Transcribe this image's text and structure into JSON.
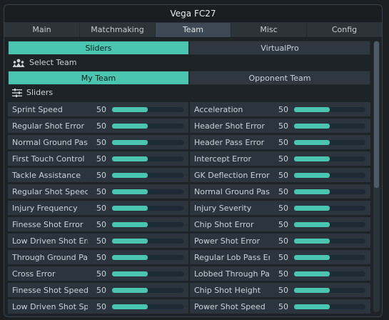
{
  "window": {
    "title": "Vega FC27"
  },
  "tabs": [
    {
      "label": "Main",
      "active": false
    },
    {
      "label": "Matchmaking",
      "active": false
    },
    {
      "label": "Team",
      "active": true
    },
    {
      "label": "Misc",
      "active": false
    },
    {
      "label": "Config",
      "active": false
    }
  ],
  "mode_tabs": [
    {
      "label": "Sliders",
      "active": true
    },
    {
      "label": "VirtualPro",
      "active": false
    }
  ],
  "select_team": {
    "label": "Select Team",
    "icon": "team-icon"
  },
  "team_tabs": [
    {
      "label": "My Team",
      "active": true
    },
    {
      "label": "Opponent Team",
      "active": false
    }
  ],
  "sliders_section": {
    "label": "Sliders",
    "icon": "sliders-icon"
  },
  "colors": {
    "accent": "#49c5b1",
    "track": "#1c2a36",
    "row_bg": "#2c353d"
  },
  "slider_max": 100,
  "sliders": [
    {
      "label": "Sprint Speed",
      "value": 50
    },
    {
      "label": "Acceleration",
      "value": 50
    },
    {
      "label": "Regular Shot Error",
      "value": 50
    },
    {
      "label": "Header Shot Error",
      "value": 50
    },
    {
      "label": "Normal Ground Pass",
      "value": 50
    },
    {
      "label": "Header Pass Error",
      "value": 50
    },
    {
      "label": "First Touch Control E",
      "value": 50
    },
    {
      "label": "Intercept Error",
      "value": 50
    },
    {
      "label": "Tackle Assistance",
      "value": 50
    },
    {
      "label": "GK Deflection Error",
      "value": 50
    },
    {
      "label": "Regular Shot Speed",
      "value": 50
    },
    {
      "label": "Normal Ground Pass",
      "value": 50
    },
    {
      "label": "Injury Frequency",
      "value": 50
    },
    {
      "label": "Injury Severity",
      "value": 50
    },
    {
      "label": "Finesse Shot Error",
      "value": 50
    },
    {
      "label": "Chip Shot Error",
      "value": 50
    },
    {
      "label": "Low Driven Shot Erro",
      "value": 50
    },
    {
      "label": "Power Shot Error",
      "value": 50
    },
    {
      "label": "Through Ground Pas",
      "value": 50
    },
    {
      "label": "Regular Lob Pass Err",
      "value": 50
    },
    {
      "label": "Cross Error",
      "value": 50
    },
    {
      "label": "Lobbed Through Pas",
      "value": 50
    },
    {
      "label": "Finesse Shot Speed",
      "value": 50
    },
    {
      "label": "Chip Shot Height",
      "value": 50
    },
    {
      "label": "Low Driven Shot Spe",
      "value": 50
    },
    {
      "label": "Power Shot Speed",
      "value": 50
    }
  ]
}
